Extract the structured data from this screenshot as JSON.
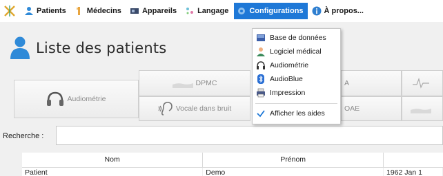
{
  "menubar": {
    "items": [
      {
        "label": "Patients",
        "icon": "user-icon"
      },
      {
        "label": "Médecins",
        "icon": "doctor-icon"
      },
      {
        "label": "Appareils",
        "icon": "device-icon"
      },
      {
        "label": "Langage",
        "icon": "speech-icon"
      },
      {
        "label": "Configurations",
        "icon": "gear-icon",
        "active": true
      },
      {
        "label": "À propos...",
        "icon": "info-icon"
      }
    ]
  },
  "page": {
    "title": "Liste des patients"
  },
  "exams": {
    "audiometrie": "Audiométrie",
    "dpmc": "DPMC",
    "vocale": "Vocale dans bruit",
    "a_partial": "A",
    "oae": "OAE"
  },
  "search": {
    "label": "Recherche :",
    "value": ""
  },
  "table": {
    "columns": [
      "Nom",
      "Prénom"
    ],
    "rows": [
      {
        "nom": "Patient",
        "prenom": "Demo",
        "date": "1962 Jan 1"
      }
    ]
  },
  "dropdown": {
    "items": [
      {
        "label": "Base de données",
        "icon": "database-icon"
      },
      {
        "label": "Logiciel médical",
        "icon": "doctor-icon"
      },
      {
        "label": "Audiométrie",
        "icon": "headphones-icon"
      },
      {
        "label": "AudioBlue",
        "icon": "bluetooth-icon"
      },
      {
        "label": "Impression",
        "icon": "printer-icon"
      }
    ],
    "toggle": {
      "label": "Afficher les aides",
      "checked": true
    }
  },
  "colors": {
    "accent": "#1e78d7",
    "user_blue": "#2f8ad8"
  }
}
